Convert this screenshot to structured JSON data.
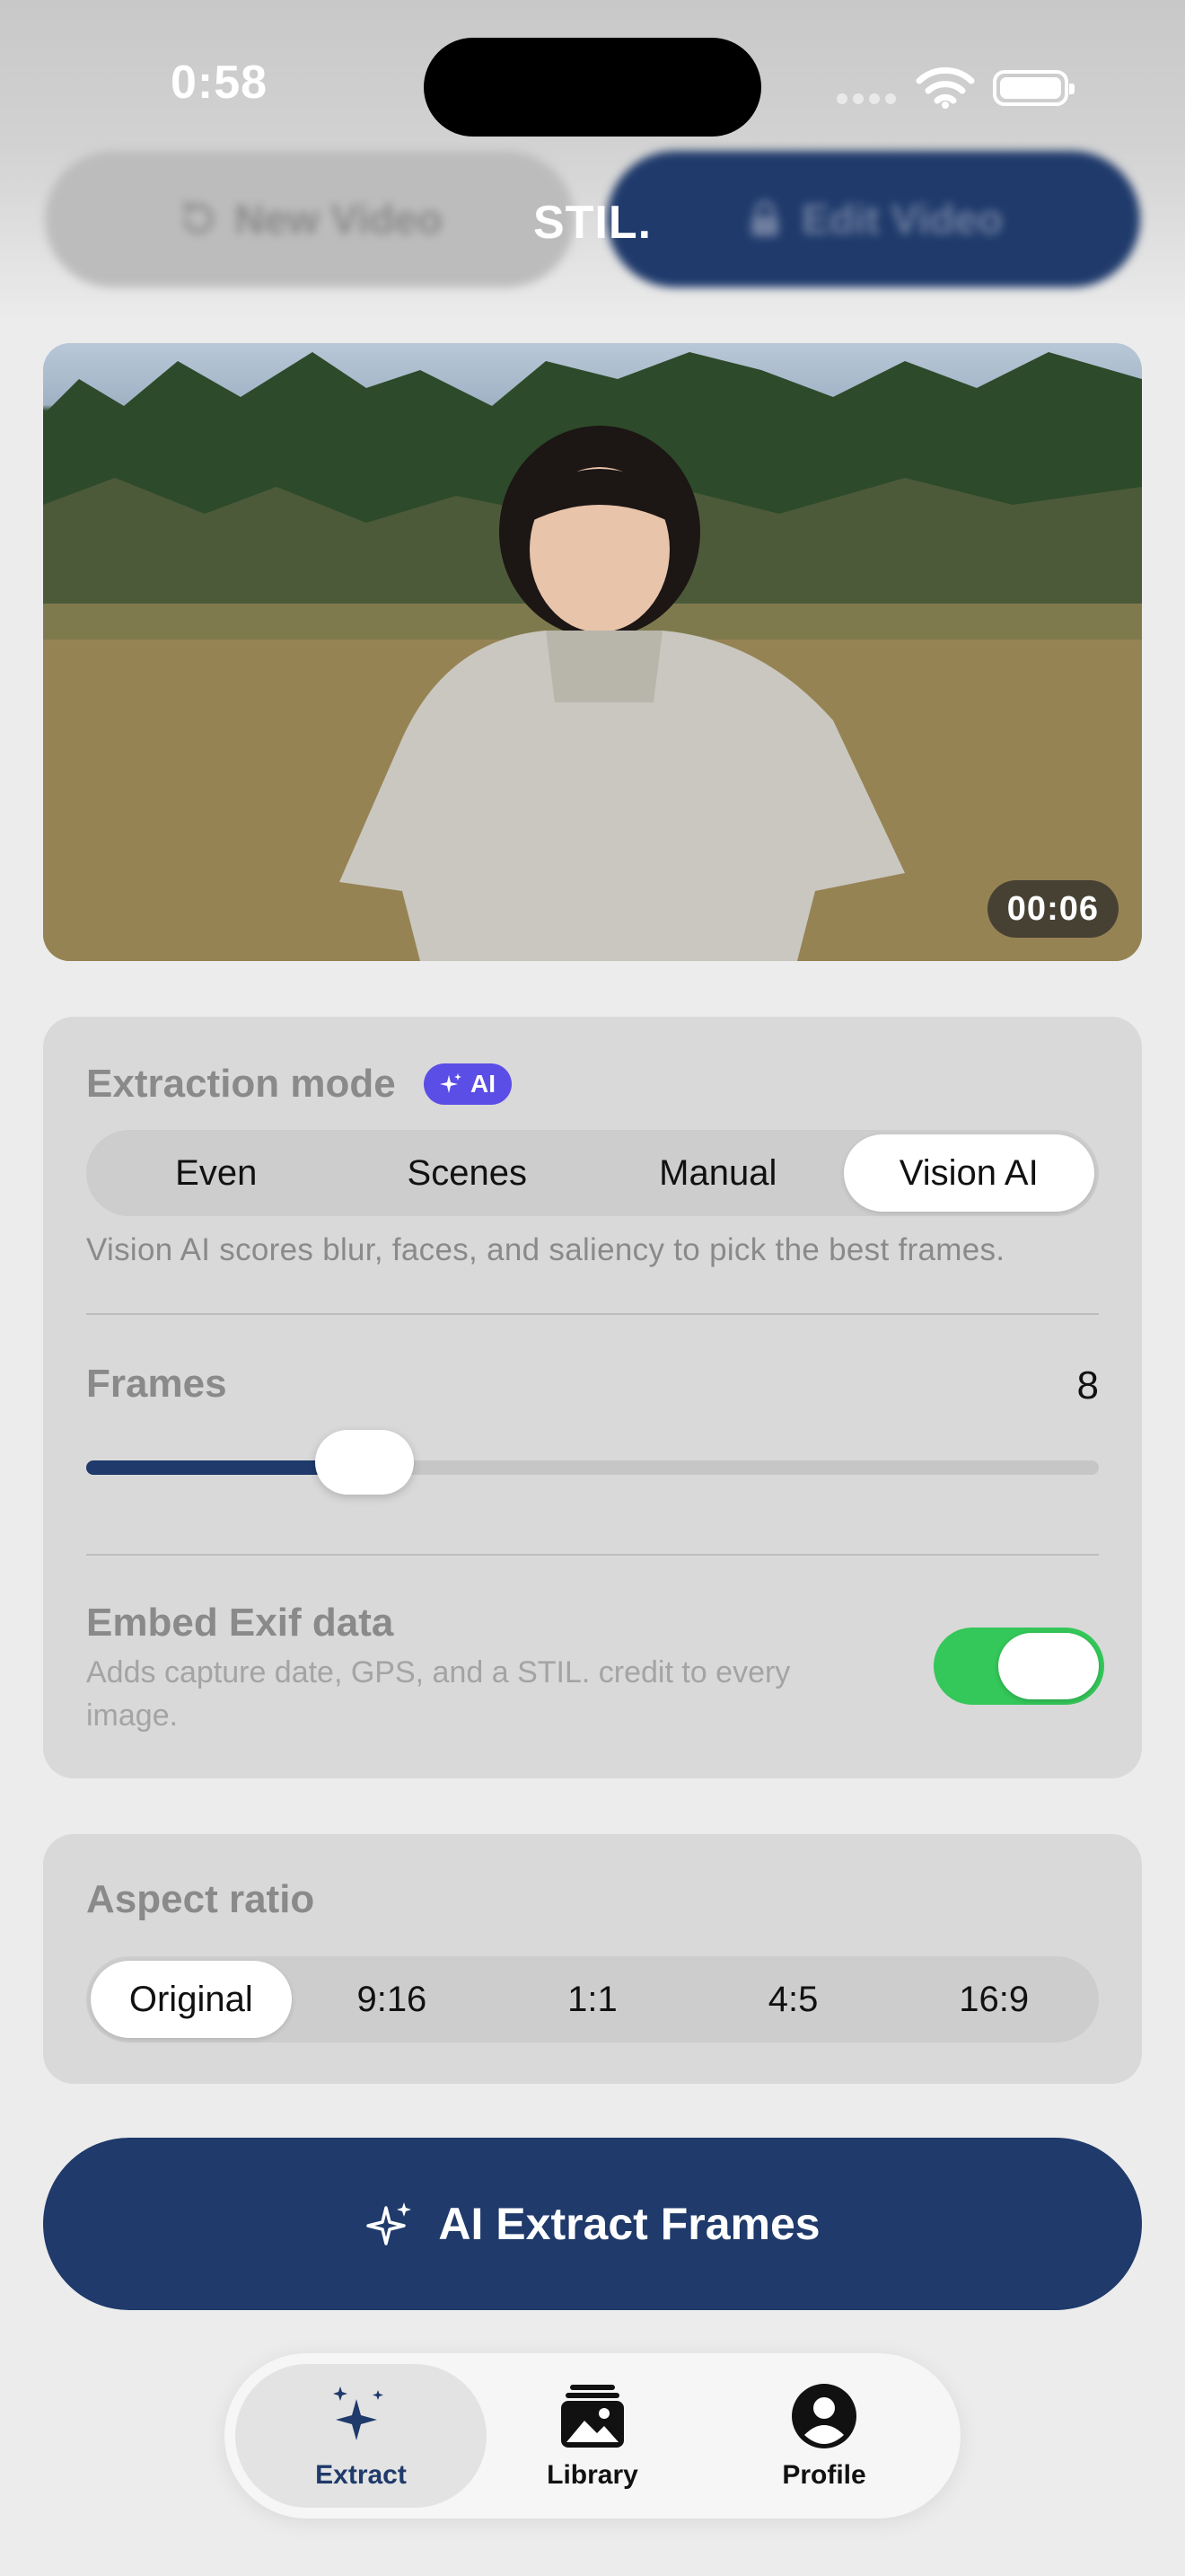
{
  "status_bar": {
    "time": "0:58"
  },
  "header": {
    "title": "STIL.",
    "new_video_label": "New Video",
    "edit_video_label": "Edit Video"
  },
  "video": {
    "duration": "00:06"
  },
  "extraction": {
    "title": "Extraction mode",
    "ai_badge": "AI",
    "modes": [
      "Even",
      "Scenes",
      "Manual",
      "Vision AI"
    ],
    "selected_mode": "Vision AI",
    "helper": "Vision AI scores blur, faces, and saliency to pick the best frames.",
    "frames_label": "Frames",
    "frames_value": "8",
    "frames_slider_fraction": 0.275,
    "exif_title": "Embed Exif data",
    "exif_description": "Adds capture date, GPS, and a STIL. credit to every image.",
    "exif_enabled": true
  },
  "aspect": {
    "title": "Aspect ratio",
    "options": [
      "Original",
      "9:16",
      "1:1",
      "4:5",
      "16:9"
    ],
    "selected": "Original"
  },
  "primary_action": {
    "label": "AI Extract Frames"
  },
  "tabbar": {
    "extract_label": "Extract",
    "library_label": "Library",
    "profile_label": "Profile"
  },
  "colors": {
    "accent": "#1f3a6b",
    "ai_badge": "#5b4ee6",
    "toggle_on": "#34c759"
  },
  "icons": {
    "new_video": "rotate-ccw-icon",
    "edit_video": "lock-icon",
    "ai": "sparkles-icon",
    "extract_tab": "sparkles-icon",
    "library_tab": "photo-stack-icon",
    "profile_tab": "person-circle-icon"
  }
}
